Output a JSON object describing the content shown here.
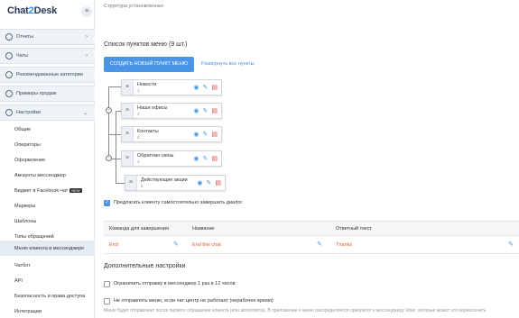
{
  "app": {
    "logo_main": "Chat",
    "logo_accent": "2",
    "logo_end": "Desk",
    "collapse_icon": "≡"
  },
  "sidebar": {
    "groups": [
      {
        "label": "Отчеты",
        "icon": "clock-icon",
        "chevron": "›"
      },
      {
        "label": "Чаты",
        "icon": "chat-icon",
        "chevron": "›"
      },
      {
        "label": "Рекомендованные категории",
        "icon": "star-icon",
        "chevron": ""
      },
      {
        "label": "Примеры продаж",
        "icon": "chart-icon",
        "chevron": ""
      },
      {
        "label": "Настройки",
        "icon": "gear-icon",
        "chevron": "⌄"
      }
    ],
    "items": [
      {
        "label": "Общие",
        "active": false
      },
      {
        "label": "Операторы",
        "active": false
      },
      {
        "label": "Оформление",
        "active": false
      },
      {
        "label": "Аккаунты мессенджер",
        "active": false
      },
      {
        "label": "Виджет в Facebook-чат",
        "active": false,
        "badge": "NEW"
      },
      {
        "label": "Маркеры",
        "active": false
      },
      {
        "label": "Шаблоны",
        "active": false
      },
      {
        "label": "Типы обращений",
        "active": false
      },
      {
        "label": "Меню клиента в мессенджере",
        "active": true
      },
      {
        "label": "Чатбот",
        "active": false
      },
      {
        "label": "API",
        "active": false
      },
      {
        "label": "Безопасность и права доступа",
        "active": false
      },
      {
        "label": "Интеграции",
        "active": false
      }
    ]
  },
  "main": {
    "breadcrumb": "Структура установленная",
    "menu_list_title": "Список пунктов меню (9 шт.)",
    "create_button": "Создать новый пункт меню",
    "expand_link": "Развернуть все пункты",
    "menu_items": [
      {
        "name": "Новости",
        "num": "1"
      },
      {
        "name": "Наши офисы",
        "num": "2"
      },
      {
        "name": "Контакты",
        "num": "4"
      },
      {
        "name": "Обратная связь",
        "num": "4"
      },
      {
        "name": "Действующие акции",
        "num": "5"
      }
    ],
    "suggest_checkbox_label": "Предлагать клиенту самостоятельно завершить диалог",
    "table_headers": {
      "command": "Команда для завершения",
      "name": "Название",
      "reply": "Ответный текст"
    },
    "table_row": {
      "command": "End",
      "name": "End this chat",
      "reply": "Thanks"
    },
    "extra_title": "Дополнительные настройки",
    "limit_checkbox_label": "Ограничить отправку в мессенджер 1 раз в 12 часов",
    "notwork_checkbox_label": "Не отправлять меню, если чат-центр не работает (нерабочее время)",
    "hint": "Меню будет отправлено после первого обращения клиента (или автоответа). В приложение и меню распределяется приоритет к мессенджеру Viber, которые может это переключить"
  },
  "colors": {
    "accent": "#4b95e6",
    "danger": "#e04848",
    "cell_text": "#e05a3a"
  }
}
